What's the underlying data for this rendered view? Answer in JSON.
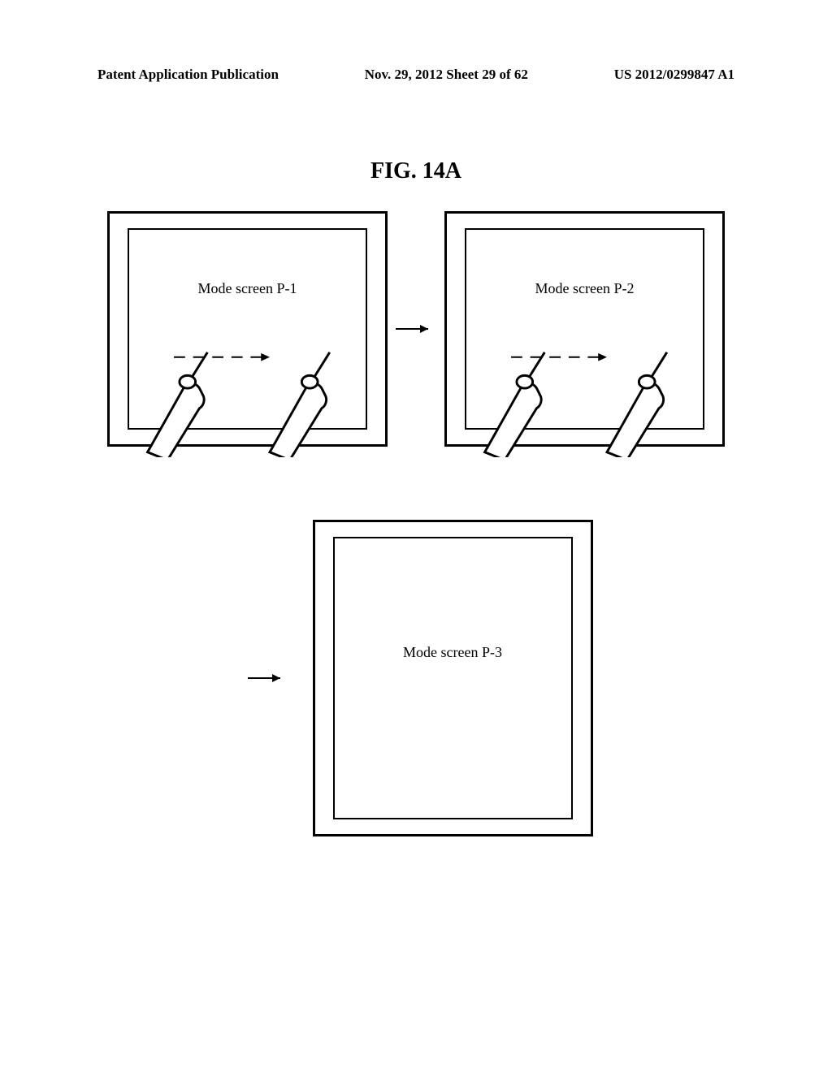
{
  "header": {
    "left": "Patent Application Publication",
    "center": "Nov. 29, 2012  Sheet 29 of 62",
    "right": "US 2012/0299847 A1"
  },
  "figure_title": "FIG. 14A",
  "panels": {
    "p1": {
      "label": "Mode screen P-1"
    },
    "p2": {
      "label": "Mode screen P-2"
    },
    "p3": {
      "label": "Mode screen P-3"
    }
  }
}
